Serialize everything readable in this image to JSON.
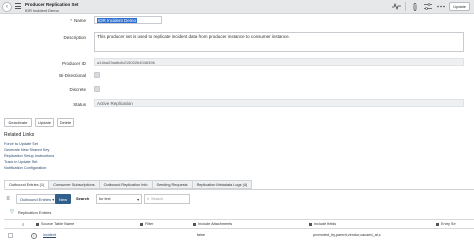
{
  "header": {
    "title": "Producer Replication Set",
    "subtitle": "IDR Incident Demo",
    "back_icon": "chevron-left-icon",
    "menu_icon": "hamburger-icon",
    "icons": [
      "pulse-icon",
      "attachment-icon",
      "sliders-icon",
      "more-icon"
    ],
    "buttons": [
      "Update"
    ]
  },
  "form": {
    "name_label": "Name",
    "name_value": "IDR Incident Demo",
    "description_label": "Description",
    "description_value": "This producer set is used to replicate incident data from producer instance to consumer instance.",
    "producer_id_label": "Producer ID",
    "producer_id_value": "a14ba29adbdb215002b4046396",
    "bidirectional_label": "Bi-Directional",
    "discrete_label": "Discrete",
    "status_label": "Status",
    "status_value": "Active Replication"
  },
  "actions": {
    "deactivate": "Deactivate",
    "update": "Update",
    "delete": "Delete"
  },
  "related_links": {
    "title": "Related Links",
    "items": [
      "Force to Update Set",
      "Generate New Shared Key",
      "Replication Setup Instructions",
      "Track in Update Set",
      "Notification Configuration"
    ]
  },
  "tabs": [
    "Outbound Entries (1)",
    "Consumer Subscriptions",
    "Outbound Replication Info",
    "Seeding Requests",
    "Replication Metadata Logs (4)"
  ],
  "list": {
    "title": "Outbound Entries",
    "new_label": "New",
    "search_label": "Search",
    "search_field": "for text",
    "search_placeholder": "Search",
    "filter_label": "Replication Entries",
    "columns": [
      "Source Table Name",
      "Filter",
      "Include Attachments",
      "Include fields",
      "Entry Se"
    ],
    "rows": [
      {
        "source_table": "incident",
        "filter": "",
        "include_attachments": "false",
        "include_fields": "promoted_by,parent,vendor,caused_at,c",
        "entry_set": ""
      }
    ]
  }
}
